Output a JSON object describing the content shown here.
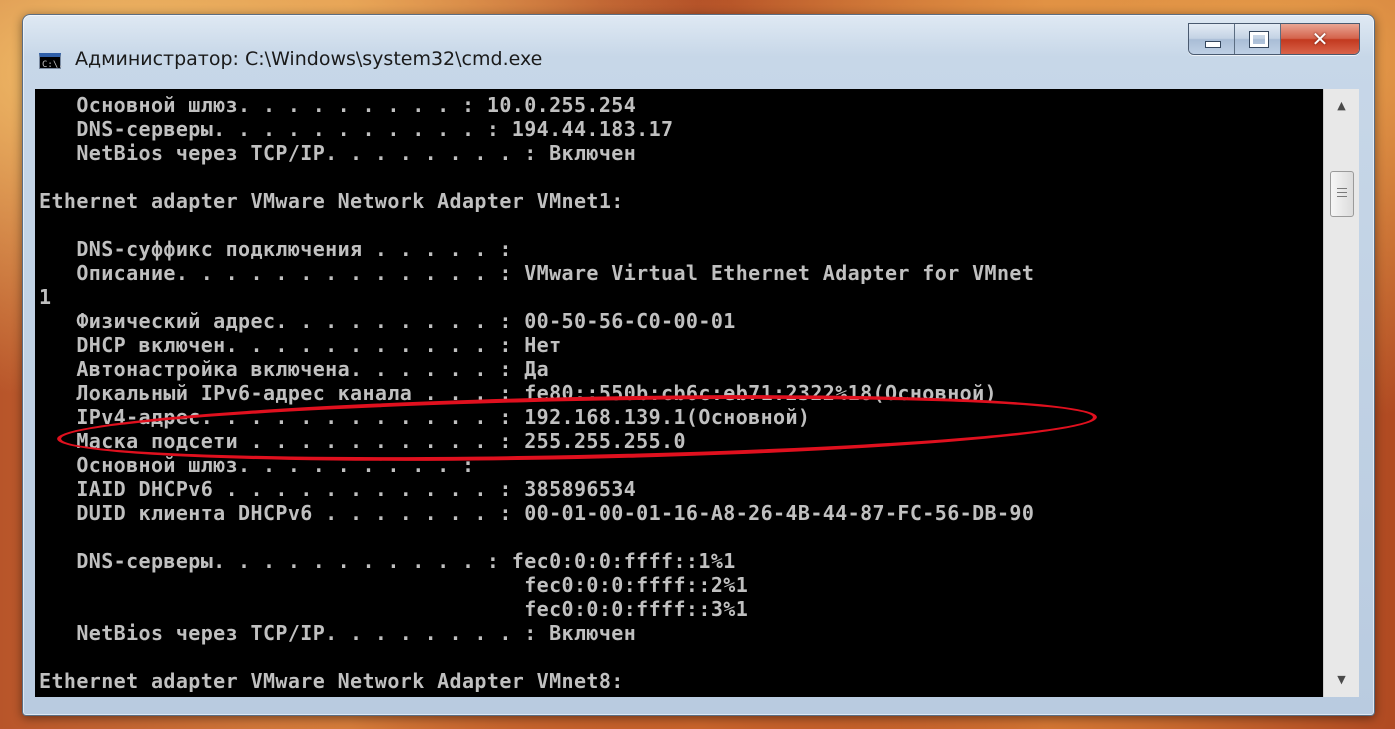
{
  "window": {
    "title": "Администратор: C:\\Windows\\system32\\cmd.exe",
    "icon_label": "C:\\.",
    "icon": "cmd-icon"
  },
  "caption_buttons": {
    "minimize_icon": "minimize-icon",
    "maximize_icon": "maximize-icon",
    "close_glyph": "✕"
  },
  "console": {
    "text_color": "#c0c0c0",
    "background": "#000000",
    "lines": [
      "   Основной шлюз. . . . . . . . . : 10.0.255.254",
      "   DNS-серверы. . . . . . . . . . . : 194.44.183.17",
      "   NetBios через TCP/IP. . . . . . . . : Включен",
      "",
      "Ethernet adapter VMware Network Adapter VMnet1:",
      "",
      "   DNS-суффикс подключения . . . . . :",
      "   Описание. . . . . . . . . . . . . : VMware Virtual Ethernet Adapter for VMnet",
      "1",
      "   Физический адрес. . . . . . . . . : 00-50-56-C0-00-01",
      "   DHCP включен. . . . . . . . . . . : Нет",
      "   Автонастройка включена. . . . . . : Да",
      "   Локальный IPv6-адрес канала . . . : fe80::550b:cb6c:eb71:2322%18(Основной)",
      "   IPv4-адрес. . . . . . . . . . . . : 192.168.139.1(Основной)",
      "   Маска подсети . . . . . . . . . . : 255.255.255.0",
      "   Основной шлюз. . . . . . . . . :",
      "   IAID DHCPv6 . . . . . . . . . . . : 385896534",
      "   DUID клиента DHCPv6 . . . . . . . : 00-01-00-01-16-A8-26-4B-44-87-FC-56-DB-90",
      "",
      "   DNS-серверы. . . . . . . . . . . : fec0:0:0:ffff::1%1",
      "                                       fec0:0:0:ffff::2%1",
      "                                       fec0:0:0:ffff::3%1",
      "   NetBios через TCP/IP. . . . . . . . : Включен",
      "",
      "Ethernet adapter VMware Network Adapter VMnet8:"
    ]
  },
  "annotation": {
    "color": "#e0101e",
    "highlighted_line": "IPv4-адрес"
  },
  "scrollbar": {
    "up_arrow": "▲",
    "down_arrow": "▼"
  }
}
